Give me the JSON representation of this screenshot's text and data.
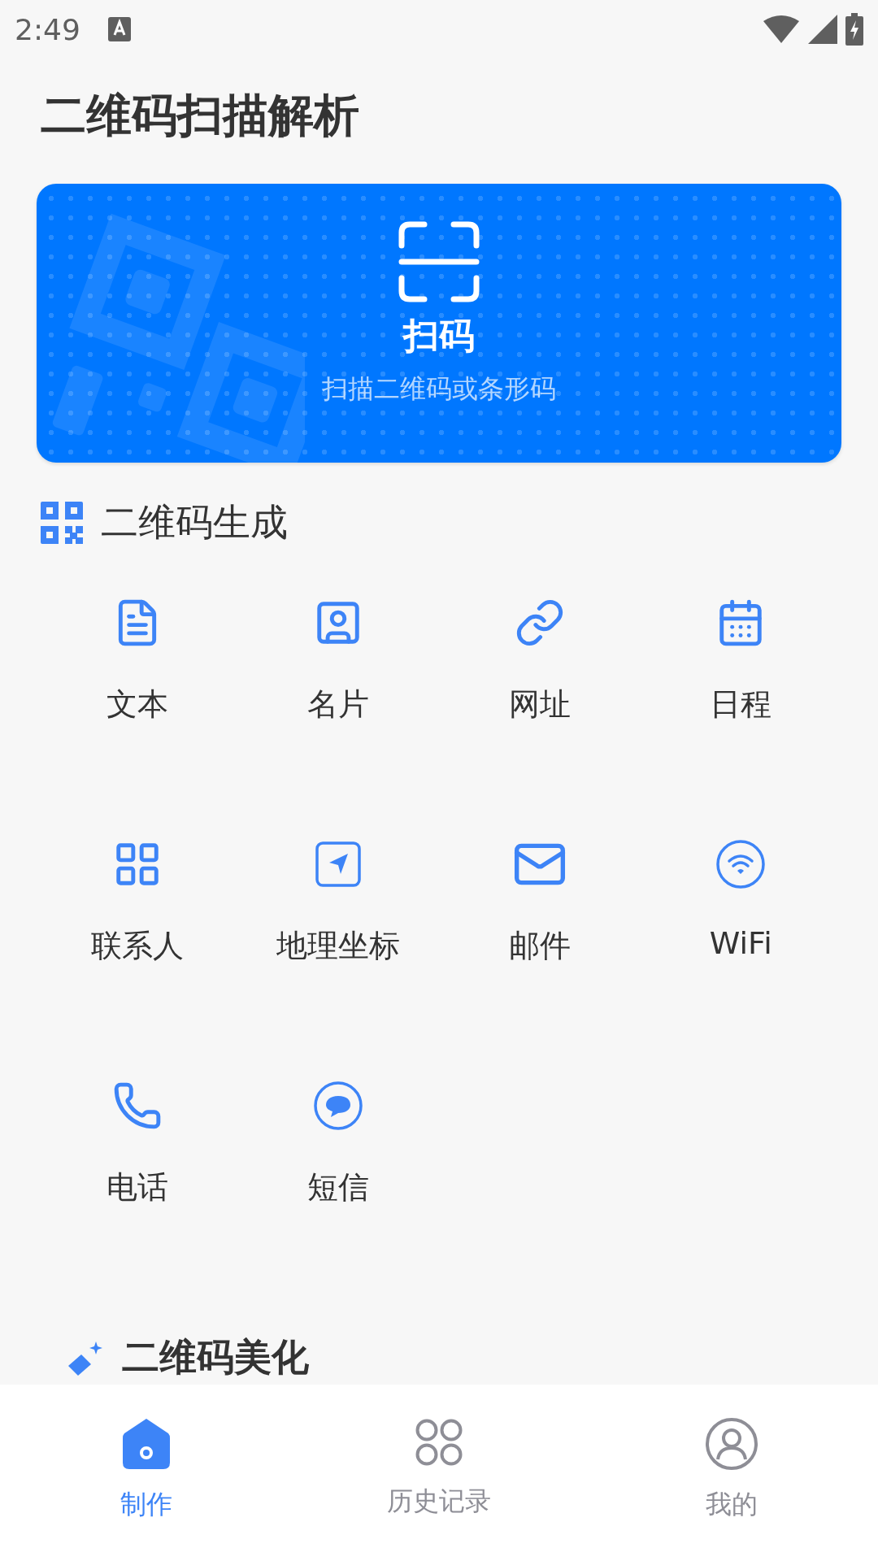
{
  "status_bar": {
    "time": "2:49"
  },
  "header": {
    "title": "二维码扫描解析"
  },
  "scan_card": {
    "title": "扫码",
    "subtitle": "扫描二维码或条形码"
  },
  "generate_section": {
    "title": "二维码生成",
    "items": [
      {
        "label": "文本"
      },
      {
        "label": "名片"
      },
      {
        "label": "网址"
      },
      {
        "label": "日程"
      },
      {
        "label": "联系人"
      },
      {
        "label": "地理坐标"
      },
      {
        "label": "邮件"
      },
      {
        "label": "WiFi"
      },
      {
        "label": "电话"
      },
      {
        "label": "短信"
      }
    ]
  },
  "beautify_section": {
    "title": "二维码美化"
  },
  "tab_bar": [
    {
      "label": "制作",
      "selected": true
    },
    {
      "label": "历史记录",
      "selected": false
    },
    {
      "label": "我的",
      "selected": false
    }
  ]
}
